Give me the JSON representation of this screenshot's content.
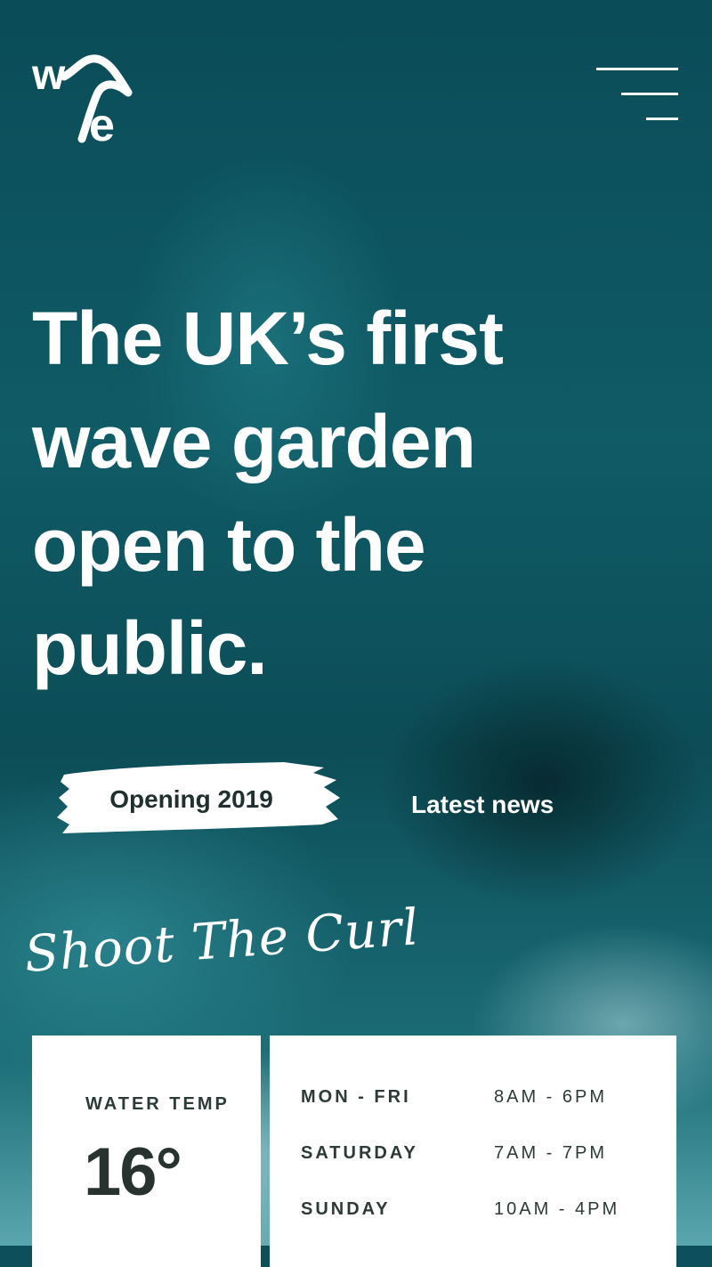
{
  "brand": {
    "logo_text": "wave",
    "logo_icon": "wave-logo-icon"
  },
  "nav": {
    "menu_icon": "hamburger-menu-icon"
  },
  "hero": {
    "headline": "The UK’s first wave garden open to the public.",
    "cta_label": "Opening 2019",
    "secondary_link": "Latest news"
  },
  "tagline": "Shoot The Curl",
  "conditions": {
    "water_temp_label": "WATER TEMP",
    "water_temp_value": "16°"
  },
  "hours": [
    {
      "day": "MON - FRI",
      "time": "8AM - 6PM"
    },
    {
      "day": "SATURDAY",
      "time": "7AM - 7PM"
    },
    {
      "day": "SUNDAY",
      "time": "10AM - 4PM"
    }
  ],
  "colors": {
    "card_bg": "#ffffff",
    "text_dark": "#2c3a38",
    "ocean": "#0d4f5a"
  }
}
